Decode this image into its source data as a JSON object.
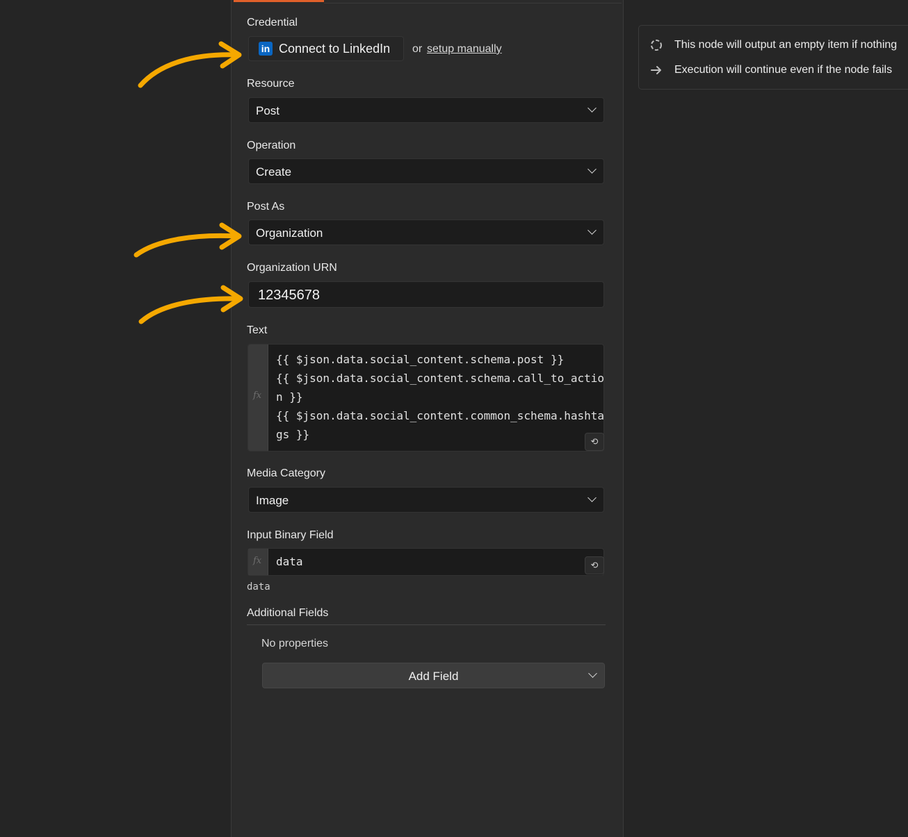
{
  "credential": {
    "label": "Credential",
    "connect_label": "Connect to LinkedIn",
    "logo_text": "in",
    "or_text": "or",
    "setup_manually_label": "setup manually"
  },
  "resource": {
    "label": "Resource",
    "value": "Post"
  },
  "operation": {
    "label": "Operation",
    "value": "Create"
  },
  "post_as": {
    "label": "Post As",
    "value": "Organization"
  },
  "organization_urn": {
    "label": "Organization URN",
    "value": "12345678"
  },
  "text": {
    "label": "Text",
    "lines": [
      "{{ $json.data.social_content.schema.post }}",
      "{{ $json.data.social_content.schema.call_to_actio",
      "n }}",
      "{{ $json.data.social_content.common_schema.hashta",
      "gs }}"
    ]
  },
  "media_category": {
    "label": "Media Category",
    "value": "Image"
  },
  "input_binary_field": {
    "label": "Input Binary Field",
    "value": "data",
    "hint": "data"
  },
  "additional_fields": {
    "label": "Additional Fields",
    "empty_text": "No properties",
    "add_button_label": "Add Field"
  },
  "settings_info": {
    "items": [
      {
        "icon": "dashed-circle-icon",
        "text": "This node will output an empty item if nothing"
      },
      {
        "icon": "arrow-right-icon",
        "text": "Execution will continue even if the node fails"
      }
    ]
  },
  "colors": {
    "accent": "#e0602a",
    "annotation_arrow": "#f5a800",
    "linkedin": "#0a66c2"
  }
}
